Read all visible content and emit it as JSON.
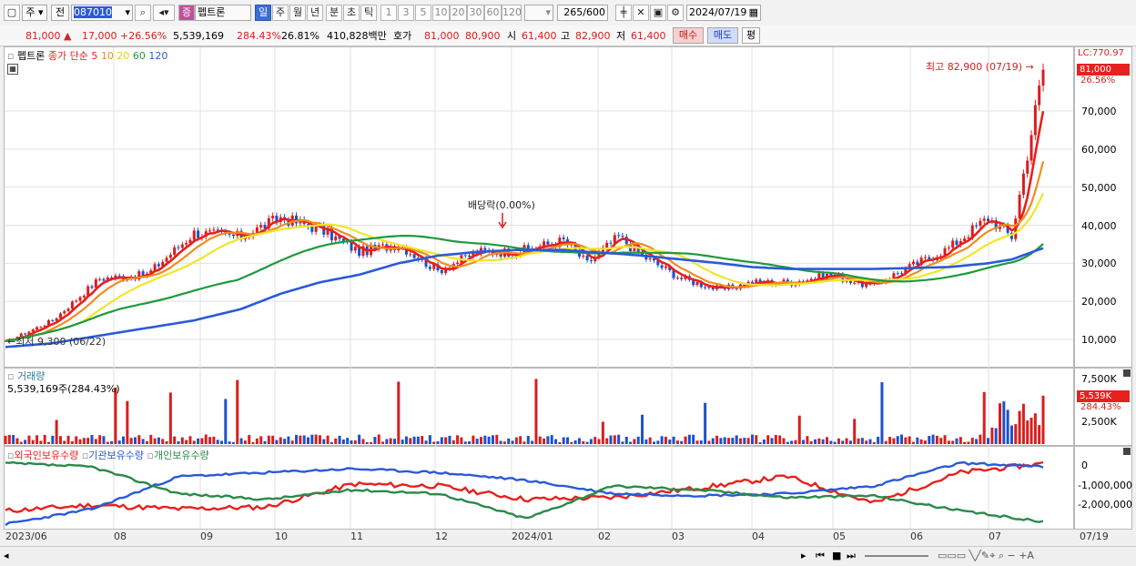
{
  "toolbar": {
    "market": "주",
    "prefix": "전",
    "code": "087010",
    "name_badge": "증",
    "name": "펩트론",
    "periods": [
      "일",
      "주",
      "월",
      "년",
      "분",
      "초",
      "틱"
    ],
    "active_period": "일",
    "intervals": [
      "1",
      "3",
      "5",
      "10",
      "20",
      "30",
      "60",
      "120"
    ],
    "count": "265",
    "count_total": "/600",
    "date": "2024/07/19"
  },
  "quote": {
    "price": "81,000",
    "change": "17,000",
    "change_rate": "+26.56%",
    "volume": "5,539,169",
    "volume_rate": "284.43%",
    "turnover_rate": "26.81%",
    "amount": "410,828백만",
    "hoga_label": "호가",
    "ask": "81,000",
    "bid": "80,900",
    "open_label": "시",
    "open": "61,400",
    "high_label": "고",
    "high": "82,900",
    "low_label": "저",
    "low": "61,400",
    "buy_label": "매수",
    "sell_label": "매도",
    "avg_label": "평"
  },
  "price_panel": {
    "legend_name": "펩트론",
    "legend_ma": "종가 단순",
    "ma_periods": [
      "5",
      "10",
      "20",
      "60",
      "120"
    ],
    "ma_colors": [
      "#e8201e",
      "#f08c1e",
      "#f0e628",
      "#1e9a3c",
      "#2a5ad8"
    ],
    "lc_label": "LC:770.97",
    "last_price_tag": "81,000",
    "last_rate_tag": "26.56%",
    "high_annotation": "최고 82,900 (07/19)",
    "low_annotation": "최저 9,300 (06/22)",
    "dividend_annotation": "배당락(0.00%)"
  },
  "volume_panel": {
    "title": "거래량",
    "value_label": "5,539,169주(284.43%)",
    "last_tag": "5,539K",
    "last_rate": "284.43%"
  },
  "investor_panel": {
    "series_labels": [
      "외국인보유수량",
      "기관보유수량",
      "개인보유수량"
    ],
    "colors": [
      "#e8201e",
      "#2a5ad8",
      "#2a8a4a"
    ]
  },
  "chart_data": [
    {
      "type": "line",
      "title": "펩트론",
      "x_labels": [
        "2023/06",
        "08",
        "09",
        "10",
        "11",
        "12",
        "2024/01",
        "02",
        "03",
        "04",
        "05",
        "06",
        "07",
        "07/19"
      ],
      "y_ticks": [
        10000,
        20000,
        30000,
        40000,
        50000,
        60000,
        70000
      ],
      "ylim": [
        3000,
        79000
      ],
      "x_index": [
        0,
        12,
        24,
        36,
        48,
        60,
        70,
        80,
        90,
        100,
        110,
        120,
        130,
        142,
        148,
        156,
        162,
        172,
        182,
        190,
        200,
        210,
        220,
        232,
        240,
        250,
        256,
        264
      ],
      "series": [
        {
          "name": "종가",
          "values": [
            9300,
            15000,
            26000,
            27000,
            38000,
            37000,
            42000,
            39000,
            33000,
            35000,
            28000,
            33000,
            33000,
            36000,
            30000,
            37000,
            32000,
            26000,
            23000,
            25000,
            25000,
            27000,
            24000,
            30000,
            34000,
            42000,
            37000,
            81000
          ]
        },
        {
          "name": "MA120",
          "values": [
            8000,
            9000,
            11000,
            13000,
            15000,
            18000,
            22000,
            25000,
            27000,
            30000,
            32000,
            33000,
            33500,
            33500,
            33000,
            32500,
            32000,
            31000,
            30000,
            29000,
            28500,
            28500,
            28500,
            28800,
            29000,
            30000,
            31000,
            34000
          ]
        }
      ]
    },
    {
      "type": "bar",
      "title": "거래량",
      "y_ticks": [
        2500000,
        5000000,
        7500000
      ],
      "ylim": [
        0,
        8000000
      ],
      "last_value": 5539169
    },
    {
      "type": "line",
      "title": "보유수량",
      "series_names": [
        "외국인보유수량",
        "기관보유수량",
        "개인보유수량"
      ],
      "y_ticks": [
        0,
        -1000000,
        -2000000
      ],
      "ylim": [
        -3000000,
        500000
      ]
    }
  ],
  "axis": {
    "price_ticks": [
      "70,000",
      "60,000",
      "50,000",
      "40,000",
      "30,000",
      "20,000",
      "10,000"
    ],
    "volume_ticks": [
      "7,500K",
      "5,000K",
      "2,500K"
    ],
    "investor_ticks": [
      "0",
      "-1,000,000",
      "-2,000,000"
    ],
    "x_labels": [
      "2023/06",
      "08",
      "09",
      "10",
      "11",
      "12",
      "2024/01",
      "02",
      "03",
      "04",
      "05",
      "06",
      "07"
    ],
    "x_end": "07/19"
  }
}
